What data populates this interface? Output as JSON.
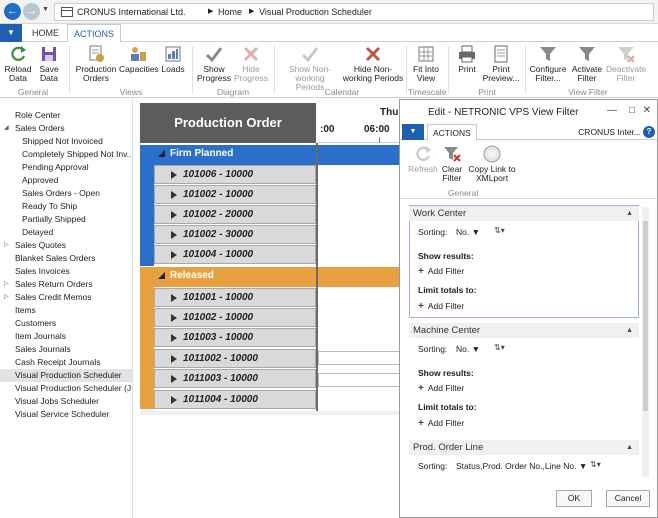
{
  "breadcrumb": {
    "company": "CRONUS International Ltd.",
    "home": "Home",
    "page": "Visual Production Scheduler"
  },
  "ribbon_tabs": [
    "HOME",
    "ACTIONS"
  ],
  "ribbon": {
    "buttons": [
      {
        "label1": "Reload",
        "label2": "Data",
        "icon": "reload-icon"
      },
      {
        "label1": "Save",
        "label2": "Data",
        "icon": "save-icon"
      },
      {
        "label1": "Production",
        "label2": "Orders",
        "icon": "production-orders-icon"
      },
      {
        "label1": "Capacities",
        "label2": "",
        "icon": "capacities-icon"
      },
      {
        "label1": "Loads",
        "label2": "",
        "icon": "loads-icon"
      },
      {
        "label1": "Show",
        "label2": "Progress",
        "icon": "check-icon"
      },
      {
        "label1": "Hide",
        "label2": "Progress",
        "icon": "x-icon"
      },
      {
        "label1": "Show Non-",
        "label2": "working Periods",
        "icon": "check-icon"
      },
      {
        "label1": "Hide Non-",
        "label2": "working Periods",
        "icon": "x-icon"
      },
      {
        "label1": "Fit Into",
        "label2": "View",
        "icon": "fit-into-view-icon"
      },
      {
        "label1": "Print",
        "label2": "",
        "icon": "print-icon"
      },
      {
        "label1": "Print",
        "label2": "Preview...",
        "icon": "print-preview-icon"
      },
      {
        "label1": "Configure",
        "label2": "Filter...",
        "icon": "filter-icon"
      },
      {
        "label1": "Activate",
        "label2": "Filter",
        "icon": "filter-icon"
      },
      {
        "label1": "Deactivate",
        "label2": "Filter",
        "icon": "filter-off-icon"
      }
    ],
    "groups": [
      "General",
      "Views",
      "Diagram",
      "Calendar",
      "Timescale",
      "Print",
      "View Filter"
    ]
  },
  "nav": {
    "items": [
      {
        "label": "Role Center"
      },
      {
        "label": "Sales Orders"
      },
      {
        "label": "Shipped Not Invoiced"
      },
      {
        "label": "Completely Shipped Not Inv..."
      },
      {
        "label": "Pending Approval"
      },
      {
        "label": "Approved"
      },
      {
        "label": "Sales Orders - Open"
      },
      {
        "label": "Ready To Ship"
      },
      {
        "label": "Partially Shipped"
      },
      {
        "label": "Delayed"
      },
      {
        "label": "Sales Quotes"
      },
      {
        "label": "Blanket Sales Orders"
      },
      {
        "label": "Sales Invoices"
      },
      {
        "label": "Sales Return Orders"
      },
      {
        "label": "Sales Credit Memos"
      },
      {
        "label": "Items"
      },
      {
        "label": "Customers"
      },
      {
        "label": "Item Journals"
      },
      {
        "label": "Sales Journals"
      },
      {
        "label": "Cash Receipt Journals"
      },
      {
        "label": "Visual Production Scheduler"
      },
      {
        "label": "Visual Production Scheduler (J..."
      },
      {
        "label": "Visual Jobs Scheduler"
      },
      {
        "label": "Visual Service Scheduler"
      }
    ]
  },
  "scheduler": {
    "header": "Production Order",
    "time_labels": [
      ":00",
      "06:00",
      "Thu"
    ],
    "groups": [
      {
        "label": "Firm Planned",
        "color": "#2a6fc9",
        "rows": [
          "101006 - 10000",
          "101002 - 10000",
          "101002 - 20000",
          "101002 - 30000",
          "101004 - 10000"
        ]
      },
      {
        "label": "Released",
        "color": "#e8a040",
        "rows": [
          "101001 - 10000",
          "101002 - 10000",
          "101003 - 10000",
          "1011002 - 10000",
          "1011003 - 10000",
          "1011004 - 10000"
        ]
      }
    ]
  },
  "dialog": {
    "title": "Edit - NETRONIC VPS View Filter",
    "tab": "ACTIONS",
    "company": "CRONUS Inter...",
    "buttons": [
      {
        "label1": "Refresh",
        "label2": "",
        "icon": "refresh-icon"
      },
      {
        "label1": "Clear",
        "label2": "Filter",
        "icon": "clear-filter-icon"
      },
      {
        "label1": "Copy Link to",
        "label2": "XMLport",
        "icon": "link-icon"
      }
    ],
    "group": "General",
    "sections": [
      {
        "title": "Work Center",
        "sorting_label": "Sorting:",
        "sorting_value": "No.",
        "show_results": "Show results:",
        "add_filter": "Add Filter",
        "limit_totals": "Limit totals to:",
        "add_filter2": "Add Filter"
      },
      {
        "title": "Machine Center",
        "sorting_label": "Sorting:",
        "sorting_value": "No.",
        "show_results": "Show results:",
        "add_filter": "Add Filter",
        "limit_totals": "Limit totals to:",
        "add_filter2": "Add Filter"
      },
      {
        "title": "Prod. Order Line",
        "sorting_label": "Sorting:",
        "sorting_value": "Status,Prod. Order No.,Line No."
      }
    ],
    "ok": "OK",
    "cancel": "Cancel"
  }
}
